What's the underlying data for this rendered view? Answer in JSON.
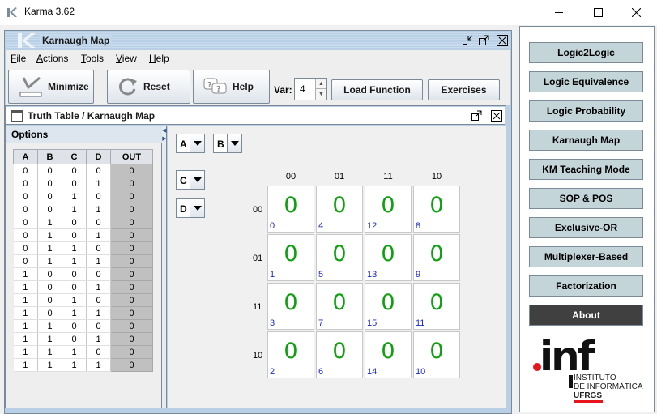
{
  "window": {
    "title": "Karma 3.62"
  },
  "frame": {
    "title": "Karnaugh Map",
    "menu": [
      "File",
      "Actions",
      "Tools",
      "View",
      "Help"
    ],
    "toolbar": {
      "minimize_label": "Minimize",
      "reset_label": "Reset",
      "help_label": "Help",
      "var_label": "Var:",
      "var_value": "4",
      "load_function_label": "Load Function",
      "exercises_label": "Exercises"
    }
  },
  "truth_table_frame": {
    "title": "Truth Table / Karnaugh Map",
    "options_label": "Options",
    "columns": [
      "A",
      "B",
      "C",
      "D",
      "OUT"
    ],
    "rows": [
      [
        "0",
        "0",
        "0",
        "0",
        "0"
      ],
      [
        "0",
        "0",
        "0",
        "1",
        "0"
      ],
      [
        "0",
        "0",
        "1",
        "0",
        "0"
      ],
      [
        "0",
        "0",
        "1",
        "1",
        "0"
      ],
      [
        "0",
        "1",
        "0",
        "0",
        "0"
      ],
      [
        "0",
        "1",
        "0",
        "1",
        "0"
      ],
      [
        "0",
        "1",
        "1",
        "0",
        "0"
      ],
      [
        "0",
        "1",
        "1",
        "1",
        "0"
      ],
      [
        "1",
        "0",
        "0",
        "0",
        "0"
      ],
      [
        "1",
        "0",
        "0",
        "1",
        "0"
      ],
      [
        "1",
        "0",
        "1",
        "0",
        "0"
      ],
      [
        "1",
        "0",
        "1",
        "1",
        "0"
      ],
      [
        "1",
        "1",
        "0",
        "0",
        "0"
      ],
      [
        "1",
        "1",
        "0",
        "1",
        "0"
      ],
      [
        "1",
        "1",
        "1",
        "0",
        "0"
      ],
      [
        "1",
        "1",
        "1",
        "1",
        "0"
      ]
    ]
  },
  "kmap": {
    "var_selectors": [
      "A",
      "B",
      "C",
      "D"
    ],
    "col_headers": [
      "00",
      "01",
      "11",
      "10"
    ],
    "row_headers": [
      "00",
      "01",
      "11",
      "10"
    ],
    "cells": [
      [
        {
          "v": "0",
          "i": "0"
        },
        {
          "v": "0",
          "i": "4"
        },
        {
          "v": "0",
          "i": "12"
        },
        {
          "v": "0",
          "i": "8"
        }
      ],
      [
        {
          "v": "0",
          "i": "1"
        },
        {
          "v": "0",
          "i": "5"
        },
        {
          "v": "0",
          "i": "13"
        },
        {
          "v": "0",
          "i": "9"
        }
      ],
      [
        {
          "v": "0",
          "i": "3"
        },
        {
          "v": "0",
          "i": "7"
        },
        {
          "v": "0",
          "i": "15"
        },
        {
          "v": "0",
          "i": "11"
        }
      ],
      [
        {
          "v": "0",
          "i": "2"
        },
        {
          "v": "0",
          "i": "6"
        },
        {
          "v": "0",
          "i": "14"
        },
        {
          "v": "0",
          "i": "10"
        }
      ]
    ]
  },
  "right_panel": {
    "buttons": [
      "Logic2Logic",
      "Logic Equivalence",
      "Logic Probability",
      "Karnaugh Map",
      "KM Teaching Mode",
      "SOP & POS",
      "Exclusive-OR",
      "Multiplexer-Based",
      "Factorization",
      "About"
    ],
    "logo": {
      "mark": ".inf",
      "line1": "INSTITUTO",
      "line2": "DE INFORMÁTICA",
      "line3": "UFRGS"
    }
  },
  "colors": {
    "kmap_value": "#0fa00f",
    "kmap_index": "#1a2acc",
    "right_button": "#c4d5da",
    "about_button": "#404040",
    "logo_red": "#e8161c"
  }
}
